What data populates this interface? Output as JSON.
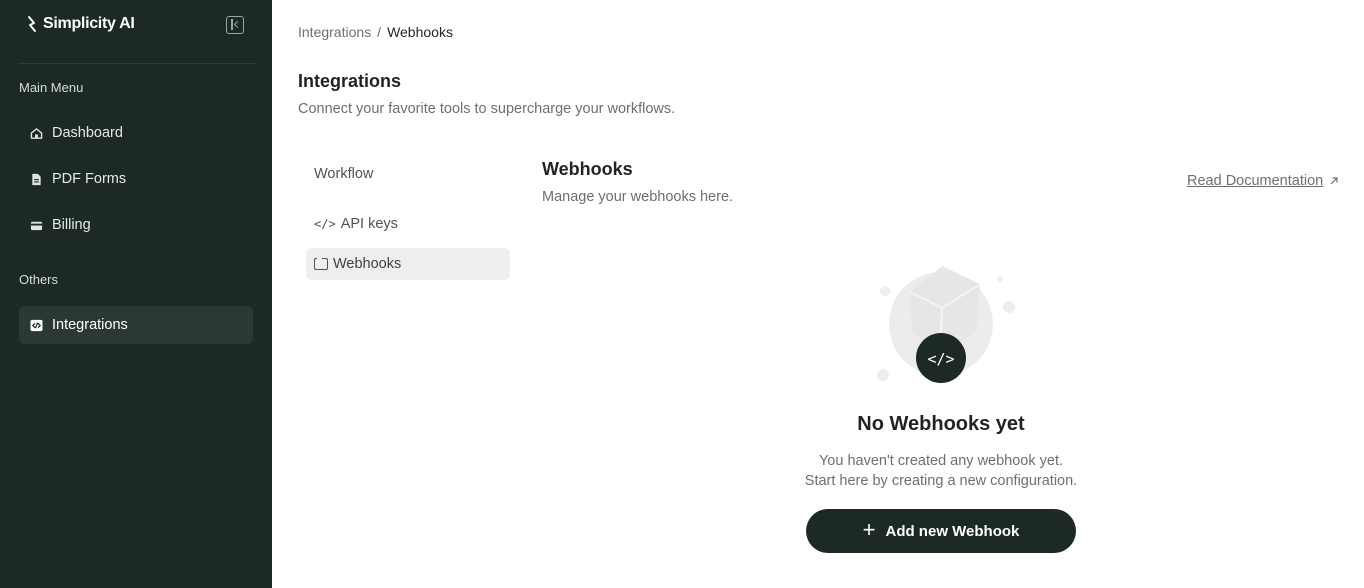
{
  "app": {
    "name": "Simplicity AI"
  },
  "sidebar": {
    "main_menu_label": "Main Menu",
    "items": [
      {
        "label": "Dashboard",
        "icon": "home-icon"
      },
      {
        "label": "PDF Forms",
        "icon": "document-icon"
      },
      {
        "label": "Billing",
        "icon": "wallet-icon"
      }
    ],
    "others_label": "Others",
    "others_items": [
      {
        "label": "Integrations",
        "icon": "code-icon",
        "active": true
      }
    ]
  },
  "breadcrumb": {
    "parent": "Integrations",
    "separator": "/",
    "current": "Webhooks"
  },
  "page": {
    "title": "Integrations",
    "subtitle": "Connect your favorite tools to supercharge your workflows."
  },
  "subnav": {
    "items": [
      {
        "label": "Workflow"
      },
      {
        "label": "API keys",
        "icon": "code-icon",
        "glyph": "</>"
      },
      {
        "label": "Webhooks",
        "icon": "webhook-icon",
        "active": true
      }
    ]
  },
  "section": {
    "title": "Webhooks",
    "subtitle": "Manage your webhooks here.",
    "doc_link": "Read Documentation",
    "doc_link_icon": "external-link-icon"
  },
  "empty_state": {
    "title": "No Webhooks yet",
    "line1": "You haven't created any webhook yet.",
    "line2": "Start here by creating a new configuration.",
    "button_label": "Add new Webhook",
    "badge_glyph": "</>"
  },
  "colors": {
    "sidebar_bg": "#1c2925",
    "active_nav_bg": "#2b3834",
    "primary_button": "#1c2925",
    "muted_text": "#6b716e"
  }
}
